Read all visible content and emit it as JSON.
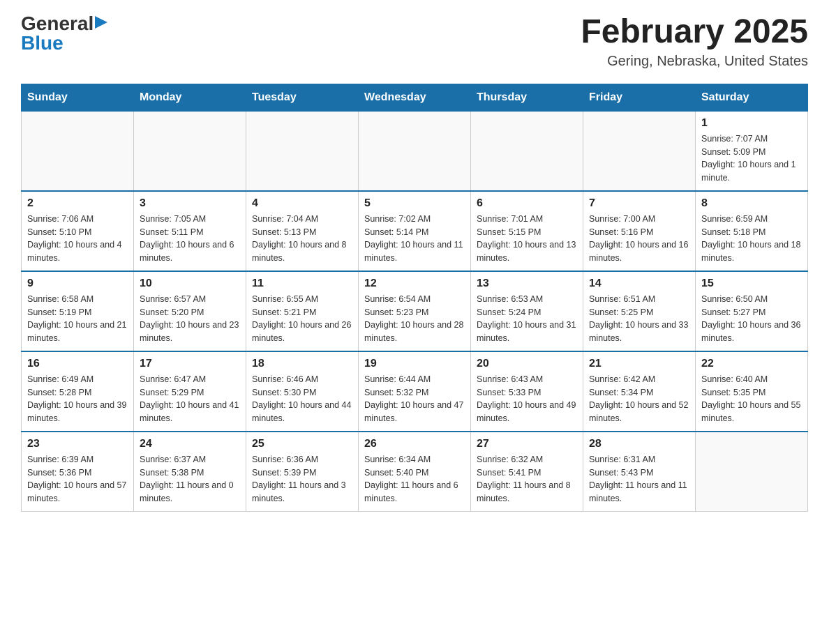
{
  "logo": {
    "general": "General",
    "blue": "Blue",
    "arrow": "▶"
  },
  "header": {
    "title": "February 2025",
    "subtitle": "Gering, Nebraska, United States"
  },
  "weekdays": [
    "Sunday",
    "Monday",
    "Tuesday",
    "Wednesday",
    "Thursday",
    "Friday",
    "Saturday"
  ],
  "weeks": [
    [
      {
        "day": "",
        "info": ""
      },
      {
        "day": "",
        "info": ""
      },
      {
        "day": "",
        "info": ""
      },
      {
        "day": "",
        "info": ""
      },
      {
        "day": "",
        "info": ""
      },
      {
        "day": "",
        "info": ""
      },
      {
        "day": "1",
        "info": "Sunrise: 7:07 AM\nSunset: 5:09 PM\nDaylight: 10 hours and 1 minute."
      }
    ],
    [
      {
        "day": "2",
        "info": "Sunrise: 7:06 AM\nSunset: 5:10 PM\nDaylight: 10 hours and 4 minutes."
      },
      {
        "day": "3",
        "info": "Sunrise: 7:05 AM\nSunset: 5:11 PM\nDaylight: 10 hours and 6 minutes."
      },
      {
        "day": "4",
        "info": "Sunrise: 7:04 AM\nSunset: 5:13 PM\nDaylight: 10 hours and 8 minutes."
      },
      {
        "day": "5",
        "info": "Sunrise: 7:02 AM\nSunset: 5:14 PM\nDaylight: 10 hours and 11 minutes."
      },
      {
        "day": "6",
        "info": "Sunrise: 7:01 AM\nSunset: 5:15 PM\nDaylight: 10 hours and 13 minutes."
      },
      {
        "day": "7",
        "info": "Sunrise: 7:00 AM\nSunset: 5:16 PM\nDaylight: 10 hours and 16 minutes."
      },
      {
        "day": "8",
        "info": "Sunrise: 6:59 AM\nSunset: 5:18 PM\nDaylight: 10 hours and 18 minutes."
      }
    ],
    [
      {
        "day": "9",
        "info": "Sunrise: 6:58 AM\nSunset: 5:19 PM\nDaylight: 10 hours and 21 minutes."
      },
      {
        "day": "10",
        "info": "Sunrise: 6:57 AM\nSunset: 5:20 PM\nDaylight: 10 hours and 23 minutes."
      },
      {
        "day": "11",
        "info": "Sunrise: 6:55 AM\nSunset: 5:21 PM\nDaylight: 10 hours and 26 minutes."
      },
      {
        "day": "12",
        "info": "Sunrise: 6:54 AM\nSunset: 5:23 PM\nDaylight: 10 hours and 28 minutes."
      },
      {
        "day": "13",
        "info": "Sunrise: 6:53 AM\nSunset: 5:24 PM\nDaylight: 10 hours and 31 minutes."
      },
      {
        "day": "14",
        "info": "Sunrise: 6:51 AM\nSunset: 5:25 PM\nDaylight: 10 hours and 33 minutes."
      },
      {
        "day": "15",
        "info": "Sunrise: 6:50 AM\nSunset: 5:27 PM\nDaylight: 10 hours and 36 minutes."
      }
    ],
    [
      {
        "day": "16",
        "info": "Sunrise: 6:49 AM\nSunset: 5:28 PM\nDaylight: 10 hours and 39 minutes."
      },
      {
        "day": "17",
        "info": "Sunrise: 6:47 AM\nSunset: 5:29 PM\nDaylight: 10 hours and 41 minutes."
      },
      {
        "day": "18",
        "info": "Sunrise: 6:46 AM\nSunset: 5:30 PM\nDaylight: 10 hours and 44 minutes."
      },
      {
        "day": "19",
        "info": "Sunrise: 6:44 AM\nSunset: 5:32 PM\nDaylight: 10 hours and 47 minutes."
      },
      {
        "day": "20",
        "info": "Sunrise: 6:43 AM\nSunset: 5:33 PM\nDaylight: 10 hours and 49 minutes."
      },
      {
        "day": "21",
        "info": "Sunrise: 6:42 AM\nSunset: 5:34 PM\nDaylight: 10 hours and 52 minutes."
      },
      {
        "day": "22",
        "info": "Sunrise: 6:40 AM\nSunset: 5:35 PM\nDaylight: 10 hours and 55 minutes."
      }
    ],
    [
      {
        "day": "23",
        "info": "Sunrise: 6:39 AM\nSunset: 5:36 PM\nDaylight: 10 hours and 57 minutes."
      },
      {
        "day": "24",
        "info": "Sunrise: 6:37 AM\nSunset: 5:38 PM\nDaylight: 11 hours and 0 minutes."
      },
      {
        "day": "25",
        "info": "Sunrise: 6:36 AM\nSunset: 5:39 PM\nDaylight: 11 hours and 3 minutes."
      },
      {
        "day": "26",
        "info": "Sunrise: 6:34 AM\nSunset: 5:40 PM\nDaylight: 11 hours and 6 minutes."
      },
      {
        "day": "27",
        "info": "Sunrise: 6:32 AM\nSunset: 5:41 PM\nDaylight: 11 hours and 8 minutes."
      },
      {
        "day": "28",
        "info": "Sunrise: 6:31 AM\nSunset: 5:43 PM\nDaylight: 11 hours and 11 minutes."
      },
      {
        "day": "",
        "info": ""
      }
    ]
  ]
}
